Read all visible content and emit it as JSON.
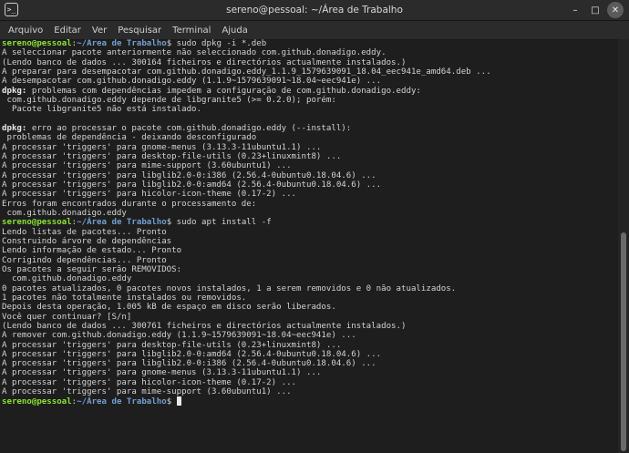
{
  "window": {
    "title": "sereno@pessoal: ~/Área de Trabalho",
    "app_icon_glyph": ">_",
    "controls": {
      "minimize": "–",
      "maximize": "□",
      "close": "✕"
    }
  },
  "menubar": {
    "items": [
      "Arquivo",
      "Editar",
      "Ver",
      "Pesquisar",
      "Terminal",
      "Ajuda"
    ]
  },
  "terminal": {
    "colors": {
      "user": "#8ae234",
      "path": "#729fcf",
      "text": "#d3d3d3",
      "background": "#1e1e1e"
    },
    "lines": [
      {
        "type": "prompt",
        "user": "sereno@pessoal",
        "sep": ":",
        "path": "~/Área de Trabalho",
        "end": "$",
        "cmd": " sudo dpkg -i *.deb"
      },
      {
        "type": "text",
        "text": "A seleccionar pacote anteriormente não seleccionado com.github.donadigo.eddy."
      },
      {
        "type": "text",
        "text": "(Lendo banco de dados ... 300164 ficheiros e directórios actualmente instalados.)"
      },
      {
        "type": "text",
        "text": "A preparar para desempacotar com.github.donadigo.eddy_1.1.9_1579639091_18.04_eec941e_amd64.deb ..."
      },
      {
        "type": "text",
        "text": "A desempacotar com.github.donadigo.eddy (1.1.9~1579639091~18.04~eec941e) ..."
      },
      {
        "type": "bold",
        "bold": "dpkg:",
        "text": " problemas com dependências impedem a configuração de com.github.donadigo.eddy:"
      },
      {
        "type": "text",
        "text": " com.github.donadigo.eddy depende de libgranite5 (>= 0.2.0); porém:"
      },
      {
        "type": "text",
        "text": "  Pacote libgranite5 não está instalado."
      },
      {
        "type": "text",
        "text": ""
      },
      {
        "type": "bold",
        "bold": "dpkg:",
        "text": " erro ao processar o pacote com.github.donadigo.eddy (--install):"
      },
      {
        "type": "text",
        "text": " problemas de dependência - deixando desconfigurado"
      },
      {
        "type": "text",
        "text": "A processar 'triggers' para gnome-menus (3.13.3-11ubuntu1.1) ..."
      },
      {
        "type": "text",
        "text": "A processar 'triggers' para desktop-file-utils (0.23+linuxmint8) ..."
      },
      {
        "type": "text",
        "text": "A processar 'triggers' para mime-support (3.60ubuntu1) ..."
      },
      {
        "type": "text",
        "text": "A processar 'triggers' para libglib2.0-0:i386 (2.56.4-0ubuntu0.18.04.6) ..."
      },
      {
        "type": "text",
        "text": "A processar 'triggers' para libglib2.0-0:amd64 (2.56.4-0ubuntu0.18.04.6) ..."
      },
      {
        "type": "text",
        "text": "A processar 'triggers' para hicolor-icon-theme (0.17-2) ..."
      },
      {
        "type": "text",
        "text": "Erros foram encontrados durante o processamento de:"
      },
      {
        "type": "text",
        "text": " com.github.donadigo.eddy"
      },
      {
        "type": "prompt",
        "user": "sereno@pessoal",
        "sep": ":",
        "path": "~/Área de Trabalho",
        "end": "$",
        "cmd": " sudo apt install -f"
      },
      {
        "type": "text",
        "text": "Lendo listas de pacotes... Pronto"
      },
      {
        "type": "text",
        "text": "Construindo árvore de dependências"
      },
      {
        "type": "text",
        "text": "Lendo informação de estado... Pronto"
      },
      {
        "type": "text",
        "text": "Corrigindo dependências... Pronto"
      },
      {
        "type": "text",
        "text": "Os pacotes a seguir serão REMOVIDOS:"
      },
      {
        "type": "text",
        "text": "  com.github.donadigo.eddy"
      },
      {
        "type": "text",
        "text": "0 pacotes atualizados, 0 pacotes novos instalados, 1 a serem removidos e 0 não atualizados."
      },
      {
        "type": "text",
        "text": "1 pacotes não totalmente instalados ou removidos."
      },
      {
        "type": "text",
        "text": "Depois desta operação, 1.005 kB de espaço em disco serão liberados."
      },
      {
        "type": "text",
        "text": "Você quer continuar? [S/n]"
      },
      {
        "type": "text",
        "text": "(Lendo banco de dados ... 300761 ficheiros e directórios actualmente instalados.)"
      },
      {
        "type": "text",
        "text": "A remover com.github.donadigo.eddy (1.1.9~1579639091~18.04~eec941e) ..."
      },
      {
        "type": "text",
        "text": "A processar 'triggers' para desktop-file-utils (0.23+linuxmint8) ..."
      },
      {
        "type": "text",
        "text": "A processar 'triggers' para libglib2.0-0:amd64 (2.56.4-0ubuntu0.18.04.6) ..."
      },
      {
        "type": "text",
        "text": "A processar 'triggers' para libglib2.0-0:i386 (2.56.4-0ubuntu0.18.04.6) ..."
      },
      {
        "type": "text",
        "text": "A processar 'triggers' para gnome-menus (3.13.3-11ubuntu1.1) ..."
      },
      {
        "type": "text",
        "text": "A processar 'triggers' para hicolor-icon-theme (0.17-2) ..."
      },
      {
        "type": "text",
        "text": "A processar 'triggers' para mime-support (3.60ubuntu1) ..."
      },
      {
        "type": "prompt",
        "user": "sereno@pessoal",
        "sep": ":",
        "path": "~/Área de Trabalho",
        "end": "$",
        "cmd": " ",
        "cursor": true
      }
    ]
  }
}
